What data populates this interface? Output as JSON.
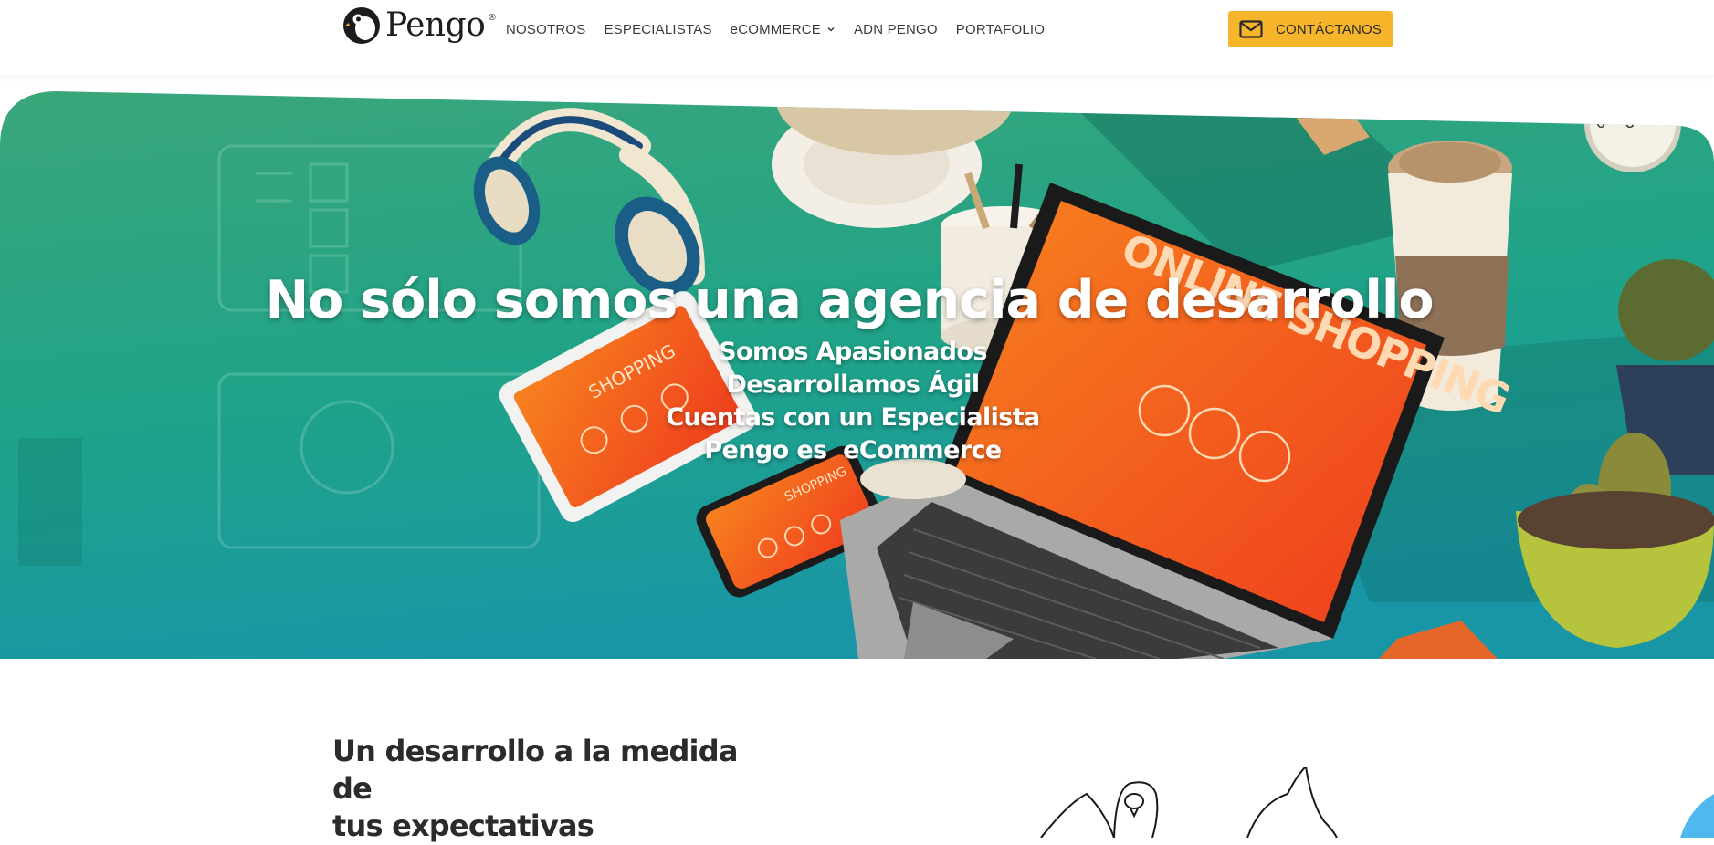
{
  "brand": {
    "name": "Pengo",
    "registered_mark": "®",
    "primary_color": "#f6b52a"
  },
  "nav": {
    "items": [
      {
        "label": "NOSOTROS"
      },
      {
        "label": "ESPECIALISTAS"
      },
      {
        "label": "eCOMMERCE",
        "has_dropdown": true,
        "icon": "chevron-down-icon"
      },
      {
        "label": "ADN PENGO"
      },
      {
        "label": "PORTAFOLIO"
      }
    ]
  },
  "cta": {
    "label": "CONTÁCTANOS",
    "icon": "envelope-icon"
  },
  "hero": {
    "title": "No sólo somos una agencia de desarrollo",
    "lines": [
      "Somos Apasionados",
      "Desarrollamos Ágil",
      "Cuentas con un Especialista",
      "Pengo es  eCommerce"
    ],
    "image_texts": {
      "laptop_screen": "ONLINE SHOPPING",
      "tablet_screen": "SHOPPING",
      "phone_screen": "SHOPPING"
    },
    "colors": {
      "background_teal": "#1fa389",
      "screen_orange": "#f0521e"
    }
  },
  "section": {
    "heading_line1": "Un desarrollo a la medida de",
    "heading_line2": "tus expectativas"
  }
}
